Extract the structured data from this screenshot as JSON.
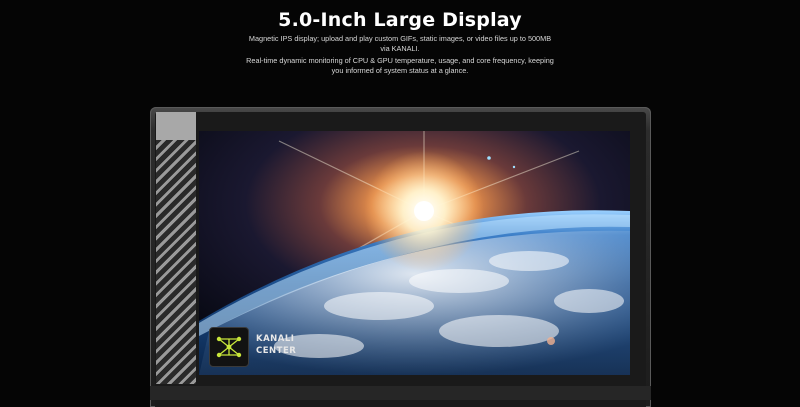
{
  "headline": "5.0-Inch Large Display",
  "description": {
    "line1": "Magnetic IPS display; upload and play custom GIFs, static images, or video files up to 500MB",
    "line2": "via KANALI.",
    "line3": "Real-time dynamic monitoring of CPU & GPU temperature, usage, and core frequency, keeping",
    "line4": "you informed of system status at a glance."
  },
  "screen_logo": {
    "icon": "kanali-network-icon",
    "line1": "KANALI",
    "line2": "CENTER",
    "accent_color": "#c8e63a"
  },
  "colors": {
    "background": "#050505",
    "text": "#ffffff"
  }
}
